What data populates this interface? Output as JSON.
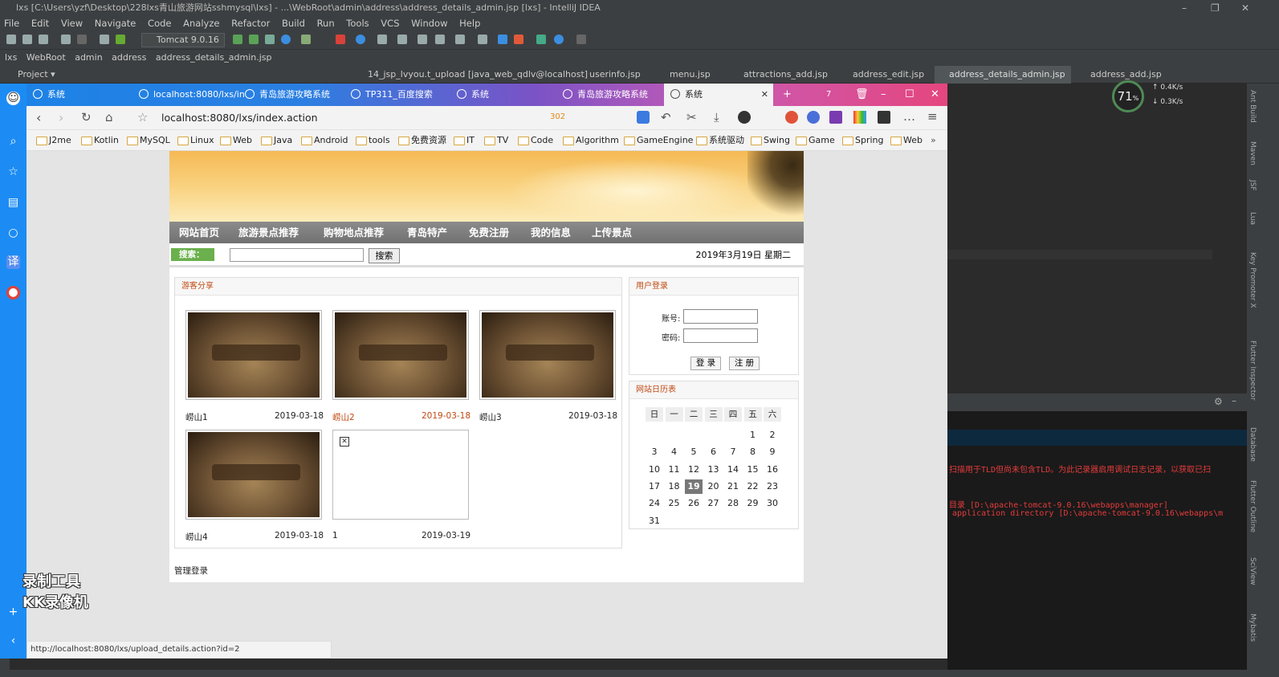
{
  "ide": {
    "title": "lxs [C:\\Users\\yzf\\Desktop\\228lxs青山旅游网站sshmysql\\lxs] - ...\\WebRoot\\admin\\address\\address_details_admin.jsp [lxs] - IntelliJ IDEA",
    "menu": [
      "File",
      "Edit",
      "View",
      "Navigate",
      "Code",
      "Analyze",
      "Refactor",
      "Build",
      "Run",
      "Tools",
      "VCS",
      "Window",
      "Help"
    ],
    "run_config": "Tomcat 9.0.16",
    "breadcrumb": [
      "lxs",
      "WebRoot",
      "admin",
      "address",
      "address_details_admin.jsp"
    ],
    "project_label": "Project",
    "tabs": [
      "14_jsp_lvyou.t_upload [java_web_qdlv@localhost]",
      "userinfo.jsp",
      "menu.jsp",
      "attractions_add.jsp",
      "address_edit.jsp",
      "address_details_admin.jsp",
      "address_add.jsp"
    ],
    "right_tools": [
      "Ant Build",
      "Maven",
      "JSF",
      "Lua",
      "Key Promoter X",
      "Flutter Inspector",
      "Database",
      "Flutter Outline",
      "SciView",
      "Mybatis"
    ],
    "console": [
      "扫描用于TLD但尚未包含TLD。为此记录器启用调试日志记录，以获取已扫",
      "目录 [D:\\apache-tomcat-9.0.16\\webapps\\manager]",
      "application directory [D:\\apache-tomcat-9.0.16\\webapps\\m"
    ],
    "net": {
      "percent": "71",
      "pct_sign": "%",
      "up": "0.4K/s",
      "down": "0.3K/s"
    }
  },
  "browser": {
    "tabs": [
      "系统",
      "localhost:8080/lxs/in",
      "青岛旅游攻略系统",
      "TP311_百度搜索",
      "系统",
      "青岛旅游攻略系统",
      "系统"
    ],
    "tab_count": "7",
    "url": "localhost:8080/lxs/index.action",
    "counter": "302",
    "bookmarks": [
      "J2me",
      "Kotlin",
      "MySQL",
      "Linux",
      "Web",
      "Java",
      "Android",
      "tools",
      "免费资源",
      "IT",
      "TV",
      "Code",
      "Algorithm",
      "GameEngine",
      "系统驱动",
      "Swing",
      "Game",
      "Spring",
      "Web"
    ],
    "status_url": "http://localhost:8080/lxs/upload_details.action?id=2"
  },
  "site": {
    "nav": [
      "网站首页",
      "旅游景点推荐",
      "购物地点推荐",
      "青岛特产",
      "免费注册",
      "我的信息",
      "上传景点"
    ],
    "search_label": "搜索：",
    "search_btn": "搜索",
    "date": "2019年3月19日 星期二",
    "share_title": "游客分享",
    "items": [
      {
        "name": "崂山1",
        "date": "2019-03-18"
      },
      {
        "name": "崂山2",
        "date": "2019-03-18"
      },
      {
        "name": "崂山3",
        "date": "2019-03-18"
      },
      {
        "name": "崂山4",
        "date": "2019-03-18"
      },
      {
        "name": "1",
        "date": "2019-03-19"
      }
    ],
    "login_title": "用户登录",
    "account_label": "账号:",
    "password_label": "密码:",
    "login_btn": "登 录",
    "register_btn": "注 册",
    "calendar_title": "网站日历表",
    "weekdays": [
      "日",
      "一",
      "二",
      "三",
      "四",
      "五",
      "六"
    ],
    "today": "19",
    "admin_link": "管理登录"
  },
  "watermark": [
    "录制工具",
    "KK录像机"
  ]
}
